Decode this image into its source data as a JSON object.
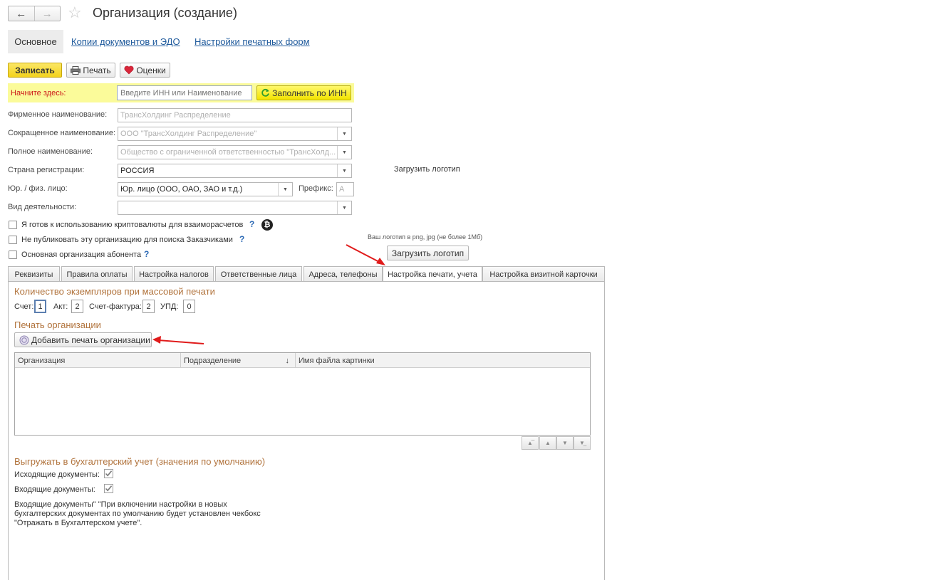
{
  "window": {
    "title": "Организация (создание)"
  },
  "form_tabs": {
    "main": "Основное",
    "copies": "Копии документов и ЭДО",
    "print_settings": "Настройки печатных форм"
  },
  "toolbar": {
    "save": "Записать",
    "print": "Печать",
    "ratings": "Оценки"
  },
  "start": {
    "label": "Начните здесь:",
    "placeholder": "Введите ИНН или Наименование",
    "fill_button": "Заполнить по ИНН"
  },
  "fields": {
    "firm_name": {
      "label": "Фирменное наименование:",
      "value": "ТрансХолдинг Распределение"
    },
    "short_name": {
      "label": "Сокращенное наименование:",
      "value": "ООО \"ТрансХолдинг Распределение\""
    },
    "full_name": {
      "label": "Полное наименование:",
      "value": "Общество с ограниченной ответственностью \"ТрансХолд..."
    },
    "country": {
      "label": "Страна регистрации:",
      "value": "РОССИЯ"
    },
    "entity_type": {
      "label": "Юр. / физ. лицо:",
      "value": "Юр. лицо (ООО, ОАО, ЗАО и т.д.)"
    },
    "prefix": {
      "label": "Префикс:",
      "value": "А"
    },
    "activity": {
      "label": "Вид деятельности:",
      "value": ""
    }
  },
  "checkboxes": {
    "crypto": "Я готов к использованию криптовалюты для взаиморасчетов",
    "no_publish": "Не публиковать эту организацию для поиска Заказчиками",
    "main_org": "Основная организация абонента"
  },
  "logo": {
    "top_link": "Загрузить логотип",
    "hint": "Ваш логотип в png, jpg (не более 1Мб)",
    "button": "Загрузить логотип"
  },
  "tabs": [
    "Реквизиты",
    "Правила оплаты",
    "Настройка налогов",
    "Ответственные лица",
    "Адреса, телефоны",
    "Настройка печати, учета",
    "Настройка визитной карточки"
  ],
  "print_section": {
    "copies_title": "Количество экземпляров при массовой печати",
    "invoice_label": "Счет:",
    "invoice_value": "1",
    "act_label": "Акт:",
    "act_value": "2",
    "tax_invoice_label": "Счет-фактура:",
    "tax_invoice_value": "2",
    "upd_label": "УПД:",
    "upd_value": "0",
    "stamp_title": "Печать организации",
    "add_stamp_button": "Добавить печать организации",
    "grid_columns": [
      "Организация",
      "Подразделение",
      "Имя файла картинки"
    ],
    "sort_indicator": "↓"
  },
  "accounting": {
    "title": "Выгружать в бухгалтерский учет (значения по умолчанию)",
    "outgoing_label": "Исходящие документы:",
    "incoming_label": "Входящие документы:",
    "outgoing_checked": true,
    "incoming_checked": true,
    "note": "Входящие документы\" \"При включении настройки в новых бухгалтерских документах по умолчанию будет установлен чекбокс \"Отражать в Бухгалтерском учете\"."
  },
  "colors": {
    "accent_link": "#1f5a9c",
    "section_title": "#b1733c",
    "highlight_band": "#fbfb9a",
    "save_button": "#f3d21d",
    "annotation_arrow": "#e01b1b"
  }
}
